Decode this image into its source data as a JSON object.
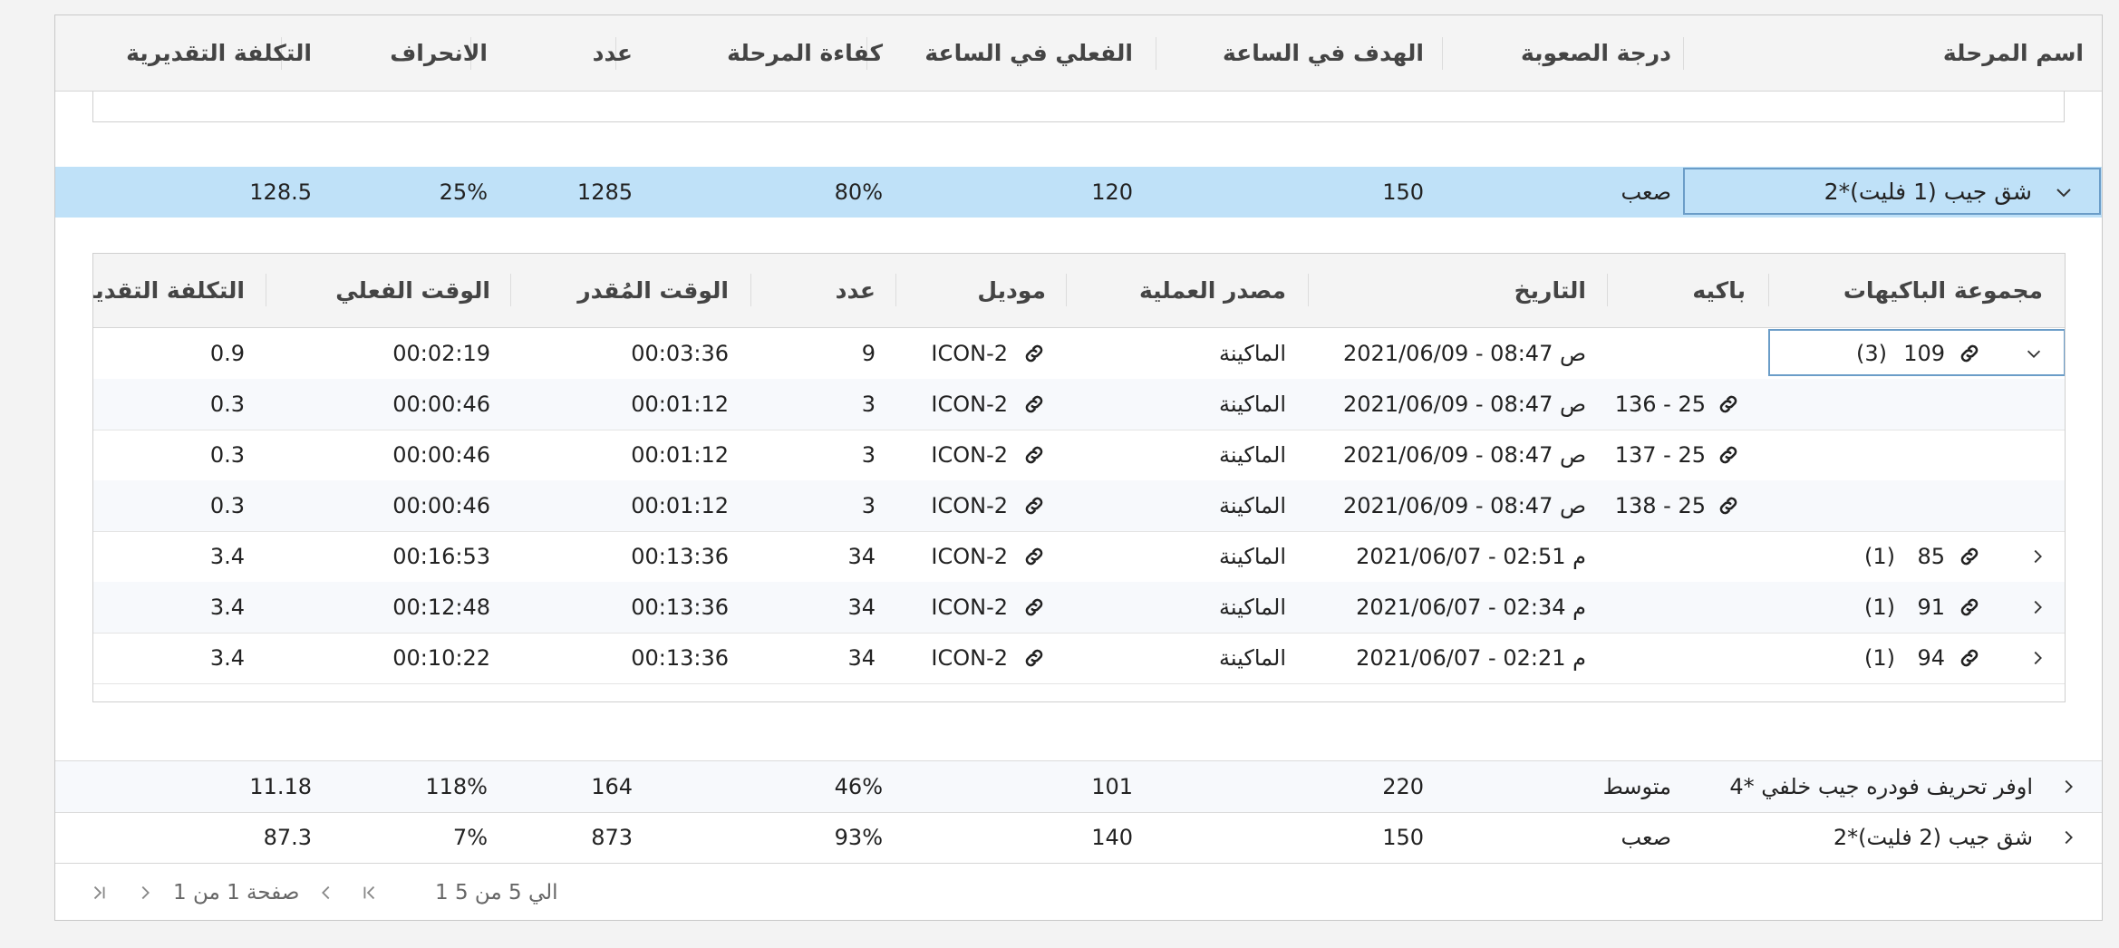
{
  "columns": {
    "name": "اسم المرحلة",
    "difficulty": "درجة الصعوبة",
    "target_hour": "الهدف في الساعة",
    "actual_hour": "الفعلي في الساعة",
    "efficiency": "كفاءة المرحلة",
    "count": "عدد",
    "deviation": "الانحراف",
    "estimated_cost": "التكلفة التقديرية"
  },
  "stages": [
    {
      "name": "شق جيب (1 فليت)*2",
      "difficulty": "صعب",
      "target": "150",
      "actual": "120",
      "efficiency": "80%",
      "count": "1285",
      "deviation": "25%",
      "cost": "128.5",
      "expanded": true
    },
    {
      "name": "اوفر تحريف فودره جيب خلفي *4",
      "difficulty": "متوسط",
      "target": "220",
      "actual": "101",
      "efficiency": "46%",
      "count": "164",
      "deviation": "118%",
      "cost": "11.18",
      "expanded": false
    },
    {
      "name": "شق جيب (2 فليت)*2",
      "difficulty": "صعب",
      "target": "150",
      "actual": "140",
      "efficiency": "93%",
      "count": "873",
      "deviation": "7%",
      "cost": "87.3",
      "expanded": false
    }
  ],
  "detail_columns": {
    "group": "مجموعة الباكيهات",
    "bundle": "باكيه",
    "date": "التاريخ",
    "source": "مصدر العملية",
    "model": "موديل",
    "count": "عدد",
    "est_time": "الوقت المُقدر",
    "act_time": "الوقت الفعلي",
    "cost": "التكلفة التقدير"
  },
  "detail_rows": [
    {
      "group_id": "109",
      "group_count": "(3)",
      "bundle": "",
      "date": "2021/06/09 - 08:47 ص",
      "source": "الماكينة",
      "model": "ICON-2",
      "count": "9",
      "est": "00:03:36",
      "act": "00:02:19",
      "cost": "0.9",
      "kind": "group-open"
    },
    {
      "group_id": "",
      "group_count": "",
      "bundle": "136 - 25",
      "date": "2021/06/09 - 08:47 ص",
      "source": "الماكينة",
      "model": "ICON-2",
      "count": "3",
      "est": "00:01:12",
      "act": "00:00:46",
      "cost": "0.3",
      "kind": "child"
    },
    {
      "group_id": "",
      "group_count": "",
      "bundle": "137 - 25",
      "date": "2021/06/09 - 08:47 ص",
      "source": "الماكينة",
      "model": "ICON-2",
      "count": "3",
      "est": "00:01:12",
      "act": "00:00:46",
      "cost": "0.3",
      "kind": "child"
    },
    {
      "group_id": "",
      "group_count": "",
      "bundle": "138 - 25",
      "date": "2021/06/09 - 08:47 ص",
      "source": "الماكينة",
      "model": "ICON-2",
      "count": "3",
      "est": "00:01:12",
      "act": "00:00:46",
      "cost": "0.3",
      "kind": "child"
    },
    {
      "group_id": "85",
      "group_count": "(1)",
      "bundle": "",
      "date": "2021/06/07 - 02:51 م",
      "source": "الماكينة",
      "model": "ICON-2",
      "count": "34",
      "est": "00:13:36",
      "act": "00:16:53",
      "cost": "3.4",
      "kind": "group-closed"
    },
    {
      "group_id": "91",
      "group_count": "(1)",
      "bundle": "",
      "date": "2021/06/07 - 02:34 م",
      "source": "الماكينة",
      "model": "ICON-2",
      "count": "34",
      "est": "00:13:36",
      "act": "00:12:48",
      "cost": "3.4",
      "kind": "group-closed"
    },
    {
      "group_id": "94",
      "group_count": "(1)",
      "bundle": "",
      "date": "2021/06/07 - 02:21 م",
      "source": "الماكينة",
      "model": "ICON-2",
      "count": "34",
      "est": "00:13:36",
      "act": "00:10:22",
      "cost": "3.4",
      "kind": "group-closed"
    }
  ],
  "pager": {
    "range": "1 الي 5 من 5",
    "page": "صفحة 1 من 1"
  },
  "colors": {
    "selected_row": "#bfe1f8",
    "selected_border": "#6b9dc8",
    "header_bg": "#f4f4f4"
  },
  "icons": {
    "link": "link-icon",
    "chevron_down": "chevron-down-icon",
    "chevron_left": "chevron-left-icon",
    "chevron_right": "chevron-right-icon",
    "first_page": "first-page-icon",
    "last_page": "last-page-icon"
  }
}
